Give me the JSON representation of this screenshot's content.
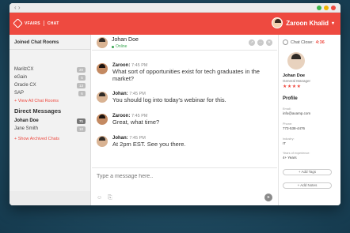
{
  "titlebar": {
    "back": "‹ ›",
    "dots": [
      "#3cb54a",
      "#f0b400",
      "#ee4a40"
    ]
  },
  "brand": {
    "name": "VFAIRS",
    "product": "CHAT"
  },
  "user": {
    "name": "Zaroon Khalid"
  },
  "sidebar": {
    "heading": "Joined Chat Rooms",
    "rooms": [
      {
        "name": "MarilzCX",
        "count": "20"
      },
      {
        "name": "eGain",
        "count": "5"
      },
      {
        "name": "Oracle CX",
        "count": "13"
      },
      {
        "name": "SAP",
        "count": "6"
      }
    ],
    "view_all": "+ View All Chat Rooms",
    "dm_heading": "Direct Messages",
    "dms": [
      {
        "name": "Johan Doe",
        "count": "71"
      },
      {
        "name": "Jane Smith",
        "count": "10"
      }
    ],
    "archived": "+ Show Archived Chats"
  },
  "chat": {
    "contact": "Johan Doe",
    "status": "Online",
    "actions": [
      "↗",
      "⋯",
      "✕"
    ],
    "messages": [
      {
        "sender": "Zaroon:",
        "time": "7:45 PM",
        "text": "What sort of opportunities exist for tech graduates in the market?",
        "who": "z"
      },
      {
        "sender": "Johan:",
        "time": "7:45 PM",
        "text": "You should log into today's webinar for this.",
        "who": "j"
      },
      {
        "sender": "Zaroon:",
        "time": "7:45 PM",
        "text": "Great, what time?",
        "who": "z"
      },
      {
        "sender": "Johan:",
        "time": "7:45 PM",
        "text": "At 2pm EST. See you there.",
        "who": "j"
      }
    ],
    "input_placeholder": "Type a message here..",
    "tools": [
      "☺",
      "⎘"
    ],
    "send": "➤"
  },
  "profile": {
    "chat_close_label": "Chat Close:",
    "chat_close_time": "4:36",
    "name": "Johan Doe",
    "role": "General Manager",
    "stars": "★★★★",
    "section": "Profile",
    "fields": [
      {
        "label": "Email:",
        "value": "info@axamp.com"
      },
      {
        "label": "Phone:",
        "value": "773-538-4476"
      },
      {
        "label": "Industry:",
        "value": "IT"
      },
      {
        "label": "Years of experience:",
        "value": "4+ Years"
      }
    ],
    "add_tags": "+ Add Tags",
    "add_notes": "+ Add Notes"
  }
}
